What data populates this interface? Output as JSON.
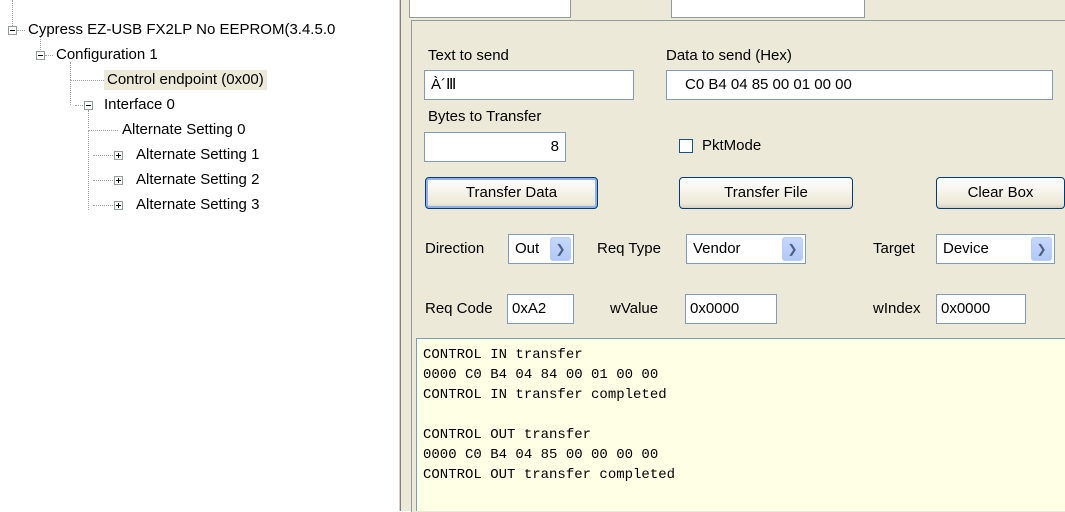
{
  "tree": {
    "device": "Cypress EZ-USB FX2LP No EEPROM(3.4.5.0",
    "configuration": "Configuration 1",
    "control_endpoint": "Control endpoint (0x00)",
    "interface": "Interface 0",
    "alt_settings": [
      "Alternate Setting 0",
      "Alternate Setting 1",
      "Alternate Setting 2",
      "Alternate Setting 3"
    ]
  },
  "form": {
    "text_to_send_label": "Text to send",
    "text_to_send_value": "À´Ⅲ",
    "data_hex_label": "Data to send (Hex)",
    "data_hex_value": "C0 B4 04 85 00 01 00 00",
    "bytes_label": "Bytes to Transfer",
    "bytes_value": "8",
    "pktmode_label": "PktMode",
    "transfer_data_label": "Transfer Data",
    "transfer_file_label": "Transfer File",
    "clear_box_label": "Clear Box",
    "direction_label": "Direction",
    "direction_value": "Out",
    "req_type_label": "Req Type",
    "req_type_value": "Vendor",
    "target_label": "Target",
    "target_value": "Device",
    "req_code_label": "Req Code",
    "req_code_value": "0xA2",
    "wvalue_label": "wValue",
    "wvalue_value": "0x0000",
    "windex_label": "wIndex",
    "windex_value": "0x0000"
  },
  "log": {
    "lines": [
      "CONTROL IN transfer",
      "0000 C0 B4 04 84 00 01 00 00",
      "CONTROL IN transfer completed",
      "",
      "CONTROL OUT transfer",
      "0000 C0 B4 04 85 00 00 00 00",
      "CONTROL OUT transfer completed"
    ]
  },
  "colors": {
    "panel_bg": "#ece9d8",
    "log_bg": "#ffffe5",
    "selection_bg": "#ece9d8"
  }
}
